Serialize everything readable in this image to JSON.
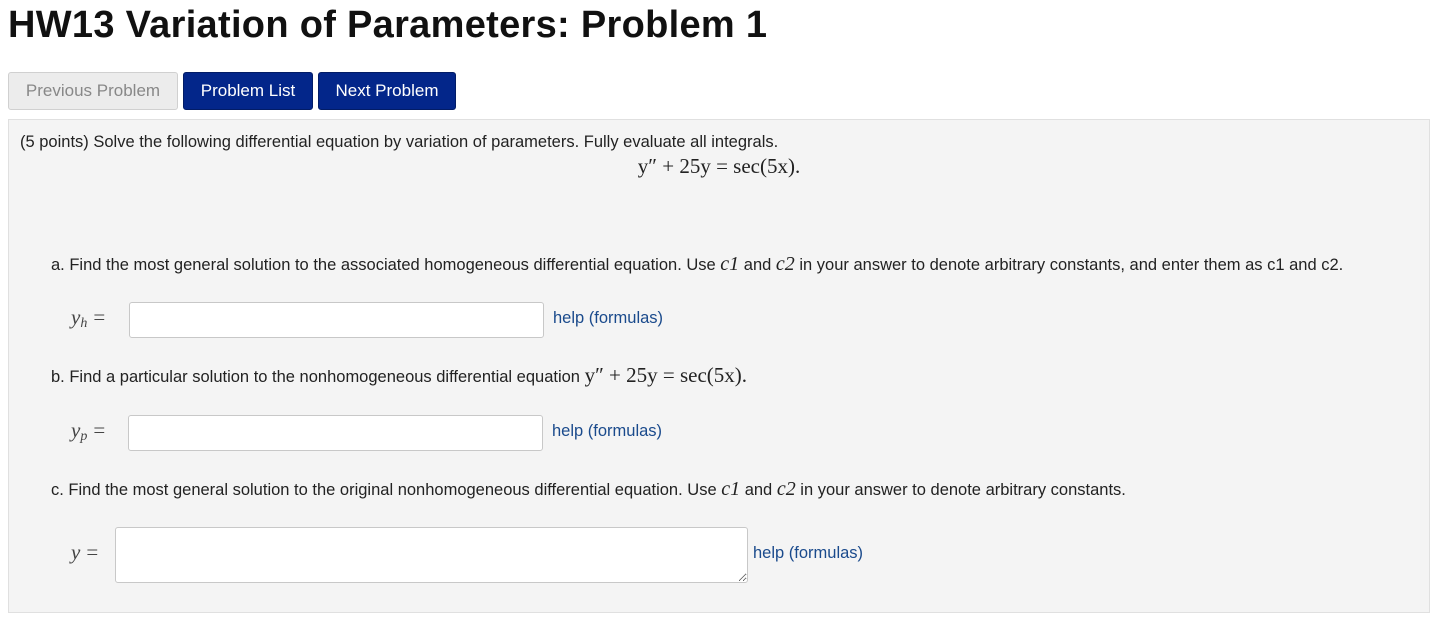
{
  "page": {
    "title": "HW13 Variation of Parameters: Problem 1"
  },
  "nav": {
    "previous_label": "Previous Problem",
    "list_label": "Problem List",
    "next_label": "Next Problem"
  },
  "problem": {
    "intro": "(5 points) Solve the following differential equation by variation of parameters. Fully evaluate all integrals.",
    "equation": "y″ + 25y = sec(5x).",
    "parts": [
      {
        "prefix": "a. Find the most general solution to the associated homogeneous differential equation. Use ",
        "c1": "c1",
        "and": " and ",
        "c2": "c2",
        "suffix": " in your answer to denote arbitrary constants, and enter them as c1 and c2.",
        "lhs_var": "y",
        "lhs_sub": "h",
        "lhs_eq": "=",
        "answer_value": "",
        "help_label": "help (formulas)"
      },
      {
        "prefix": "b. Find a particular solution to the nonhomogeneous differential equation ",
        "equation": "y″ + 25y = sec(5x).",
        "lhs_var": "y",
        "lhs_sub": "p",
        "lhs_eq": "=",
        "answer_value": "",
        "help_label": "help (formulas)"
      },
      {
        "prefix": "c. Find the most general solution to the original nonhomogeneous differential equation. Use ",
        "c1": "c1",
        "and": " and ",
        "c2": "c2",
        "suffix": " in your answer to denote arbitrary constants.",
        "lhs_var": "y",
        "lhs_eq": "=",
        "answer_value": "",
        "help_label": "help (formulas)"
      }
    ]
  },
  "colors": {
    "primary_button": "#03268a",
    "disabled_button": "#ececec",
    "link": "#1a4a8c",
    "panel": "#f4f4f4"
  }
}
